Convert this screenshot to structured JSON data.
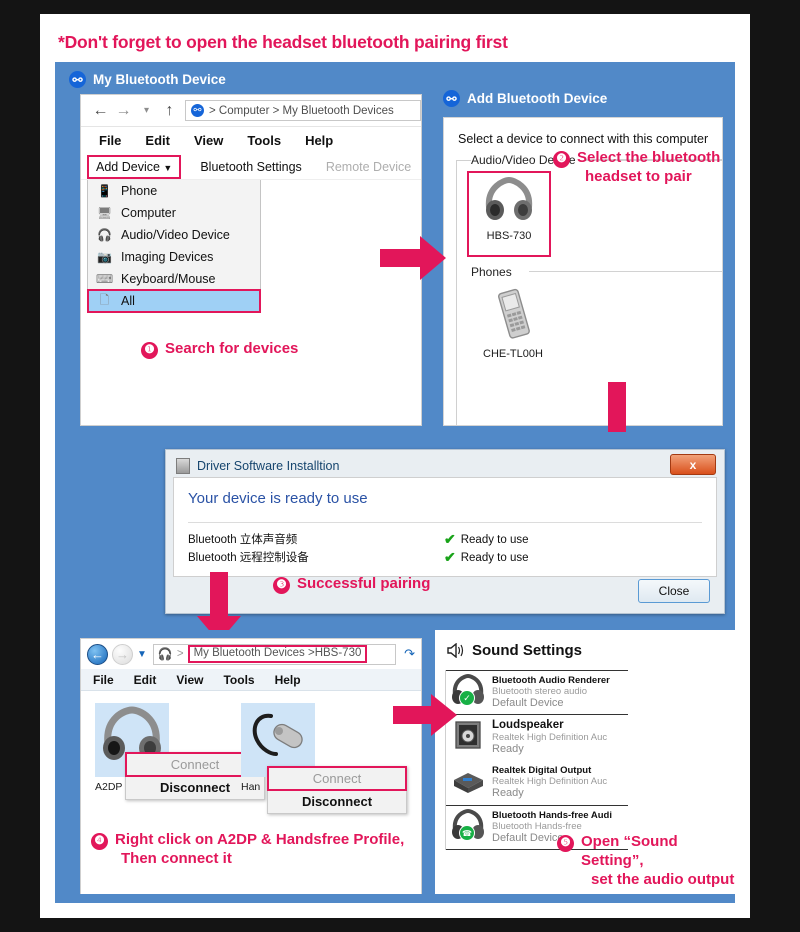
{
  "banner": {
    "text": "*Don't forget to open the headset bluetooth pairing first"
  },
  "colors": {
    "accent_red": "#e2165a",
    "panel_blue": "#5189c8",
    "bt_blue": "#1565d8",
    "highlight": "#9fd0f5",
    "check_green": "#19a319"
  },
  "section1": {
    "title": "My Bluetooth Device",
    "explorer": {
      "address": "> Computer > My Bluetooth Devices",
      "menu": [
        "File",
        "Edit",
        "View",
        "Tools",
        "Help"
      ],
      "toolbar": {
        "add_device": "Add Device",
        "bluetooth_settings": "Bluetooth Settings",
        "remote_device": "Remote Device"
      },
      "dropdown": [
        {
          "label": "Phone",
          "icon": "phone-icon",
          "selected": false
        },
        {
          "label": "Computer",
          "icon": "computer-icon",
          "selected": false
        },
        {
          "label": "Audio/Video Device",
          "icon": "headset-icon",
          "selected": false
        },
        {
          "label": "Imaging Devices",
          "icon": "imaging-icon",
          "selected": false
        },
        {
          "label": "Keyboard/Mouse",
          "icon": "keyboard-icon",
          "selected": false
        },
        {
          "label": "All",
          "icon": "all-devices-icon",
          "selected": true
        }
      ],
      "step": {
        "num": "❶",
        "text": "Search for devices"
      }
    },
    "add_device": {
      "title": "Add Bluetooth Device",
      "subtitle": "Select a device to connect with this computer",
      "groups": [
        {
          "label": "Audio/Video Device",
          "devices": [
            {
              "name": "HBS-730",
              "icon": "headphones-icon",
              "highlighted": true
            }
          ]
        },
        {
          "label": "Phones",
          "devices": [
            {
              "name": "CHE-TL00H",
              "icon": "mobile-phone-icon",
              "highlighted": false
            }
          ]
        }
      ],
      "step": {
        "num": "❷",
        "line1": "Select the bluetooth",
        "line2": "headset to pair"
      }
    }
  },
  "section2": {
    "dialog": {
      "title": "Driver Software Installtion",
      "close_x": "x",
      "heading": "Your device is ready to use",
      "rows": [
        {
          "name": "Bluetooth 立体声音频",
          "status": "Ready to use"
        },
        {
          "name": "Bluetooth 远程控制设备",
          "status": "Ready to use"
        }
      ],
      "close_button": "Close"
    },
    "step": {
      "num": "❸",
      "text": "Successful pairing"
    }
  },
  "section3": {
    "explorer": {
      "address": "My Bluetooth Devices >HBS-730",
      "menu": [
        "File",
        "Edit",
        "View",
        "Tools",
        "Help"
      ],
      "profiles": [
        {
          "label": "A2DP",
          "icon": "headphones-icon",
          "menu": {
            "connect": "Connect",
            "disconnect": "Disconnect"
          }
        },
        {
          "label": "Han",
          "icon": "earpiece-icon",
          "menu": {
            "connect": "Connect",
            "disconnect": "Disconnect"
          }
        }
      ],
      "step": {
        "num": "❹",
        "line1": "Right click on A2DP & Handsfree Profile,",
        "line2": "Then connect it"
      }
    },
    "sound": {
      "title": "Sound Settings",
      "devices": [
        {
          "name": "Bluetooth Audio Renderer",
          "desc": "Bluetooth stereo audio",
          "status": "Default Device",
          "icon": "headset-icon",
          "badge": "check",
          "selected": true
        },
        {
          "name": "Loudspeaker",
          "desc": "Realtek High Definition Auc",
          "status": "Ready",
          "icon": "speaker-icon",
          "badge": "",
          "selected": false
        },
        {
          "name": "Realtek Digital Output",
          "desc": "Realtek High Definition Auc",
          "status": "Ready",
          "icon": "digital-output-icon",
          "badge": "",
          "selected": false
        },
        {
          "name": "Bluetooth Hands-free Audi",
          "desc": "Bluetooth Hands-free",
          "status": "Default Device",
          "icon": "headset-icon",
          "badge": "phone",
          "selected": true
        }
      ],
      "step": {
        "num": "❺",
        "line1": "Open “Sound Setting”,",
        "line2": "set the audio output"
      }
    }
  }
}
